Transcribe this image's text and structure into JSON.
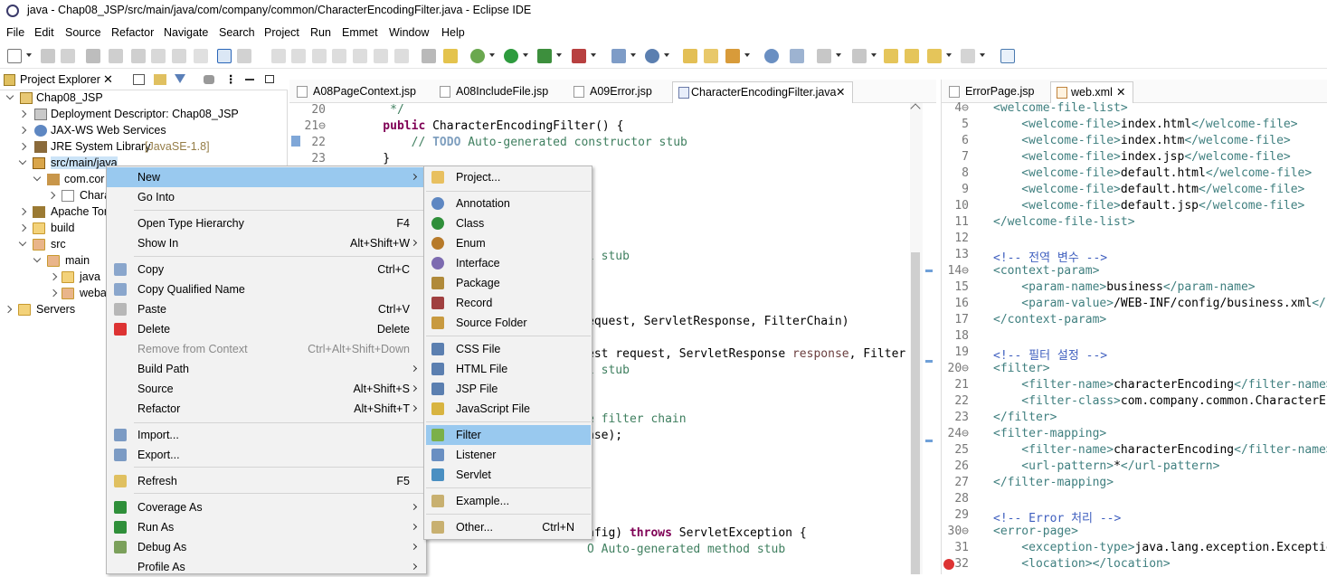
{
  "title_bar": {
    "title": "java - Chap08_JSP/src/main/java/com/company/common/CharacterEncodingFilter.java - Eclipse IDE"
  },
  "menu_bar": [
    "File",
    "Edit",
    "Source",
    "Refactor",
    "Navigate",
    "Search",
    "Project",
    "Run",
    "Emmet",
    "Window",
    "Help"
  ],
  "project_explorer": {
    "tab_label": "Project Explorer",
    "tree": [
      {
        "label": "Chap08_JSP"
      },
      {
        "label": "Deployment Descriptor: Chap08_JSP"
      },
      {
        "label": "JAX-WS Web Services"
      },
      {
        "label": "JRE System Library",
        "extra": "[JavaSE-1.8]"
      },
      {
        "label": "src/main/java"
      },
      {
        "label": "com.cor"
      },
      {
        "label": "Chara"
      },
      {
        "label": "Apache Tor"
      },
      {
        "label": "build"
      },
      {
        "label": "src"
      },
      {
        "label": "main"
      },
      {
        "label": "java"
      },
      {
        "label": "weba"
      },
      {
        "label": "Servers"
      }
    ]
  },
  "editor": {
    "tabs": [
      "A08PageContext.jsp",
      "A08IncludeFile.jsp",
      "A09Error.jsp",
      "CharacterEncodingFilter.java"
    ],
    "lines": [
      {
        "n": "20",
        "text": "     */"
      },
      {
        "n": "21⊖",
        "kw": "    public ",
        "text": "CharacterEncodingFilter() {"
      },
      {
        "n": "22",
        "cm": "        // ",
        "todo": "TODO",
        "cm2": " Auto-generated constructor stub"
      },
      {
        "n": "23",
        "text": "    }"
      }
    ],
    "fragments": {
      "f1": "l stub",
      "f2": "equest, ServletResponse, FilterChain)",
      "f3a": "est request, ServletResponse ",
      "f3b": "response",
      "f3c": ", Filter",
      "f4": "l stub",
      "f5": "e filter chain",
      "f6": "nse);",
      "f7a": "nfig) ",
      "f7b": "throws",
      "f7c": " ServletException {",
      "f8": "O Auto-generated method stub"
    }
  },
  "xml_editor": {
    "tabs": [
      "ErrorPage.jsp",
      "web.xml"
    ],
    "lines": [
      {
        "n": "4⊖",
        "t": "<welcome-file-list>"
      },
      {
        "n": "5",
        "t": "    <welcome-file>",
        "v": "index.html",
        "e": "</welcome-file>"
      },
      {
        "n": "6",
        "t": "    <welcome-file>",
        "v": "index.htm",
        "e": "</welcome-file>"
      },
      {
        "n": "7",
        "t": "    <welcome-file>",
        "v": "index.jsp",
        "e": "</welcome-file>"
      },
      {
        "n": "8",
        "t": "    <welcome-file>",
        "v": "default.html",
        "e": "</welcome-file>"
      },
      {
        "n": "9",
        "t": "    <welcome-file>",
        "v": "default.htm",
        "e": "</welcome-file>"
      },
      {
        "n": "10",
        "t": "    <welcome-file>",
        "v": "default.jsp",
        "e": "</welcome-file>"
      },
      {
        "n": "11",
        "t": "</welcome-file-list>"
      },
      {
        "n": "12",
        "t": ""
      },
      {
        "n": "13",
        "c": "<!-- 전역 변수 -->"
      },
      {
        "n": "14⊖",
        "t": "<context-param>"
      },
      {
        "n": "15",
        "t": "    <param-name>",
        "v": "business",
        "e": "</param-name>"
      },
      {
        "n": "16",
        "t": "    <param-value>",
        "v": "/WEB-INF/config/business.xml",
        "e": "</pa"
      },
      {
        "n": "17",
        "t": "</context-param>"
      },
      {
        "n": "18",
        "t": ""
      },
      {
        "n": "19",
        "c": "<!-- 필터 설정 -->"
      },
      {
        "n": "20⊖",
        "t": "<filter>"
      },
      {
        "n": "21",
        "t": "    <filter-name>",
        "v": "characterEncoding",
        "e": "</filter-name>"
      },
      {
        "n": "22",
        "t": "    <filter-class>",
        "v": "com.company.common.CharacterEnc",
        "e": ""
      },
      {
        "n": "23",
        "t": "</filter>"
      },
      {
        "n": "24⊖",
        "t": "<filter-mapping>"
      },
      {
        "n": "25",
        "t": "    <filter-name>",
        "v": "characterEncoding",
        "e": "</filter-name>"
      },
      {
        "n": "26",
        "t": "    <url-pattern>",
        "v": "*",
        "e": "</url-pattern>"
      },
      {
        "n": "27",
        "t": "</filter-mapping>"
      },
      {
        "n": "28",
        "t": ""
      },
      {
        "n": "29",
        "c": "<!-- Error 처리 -->"
      },
      {
        "n": "30⊖",
        "t": "<error-page>"
      },
      {
        "n": "31",
        "t": "    <exception-type>",
        "v": "java.lang.exception.Exceptio",
        "e": ""
      },
      {
        "n": "32",
        "t": "    <location>",
        "v": "",
        "e": "</location>"
      }
    ]
  },
  "context_menu": {
    "items": [
      {
        "label": "New",
        "shortcut": "",
        "submenu": true,
        "selected": true
      },
      {
        "label": "Go Into",
        "shortcut": ""
      },
      {
        "label": "Open Type Hierarchy",
        "shortcut": "F4"
      },
      {
        "label": "Show In",
        "shortcut": "Alt+Shift+W",
        "submenu": true
      },
      {
        "label": "Copy",
        "shortcut": "Ctrl+C"
      },
      {
        "label": "Copy Qualified Name",
        "shortcut": ""
      },
      {
        "label": "Paste",
        "shortcut": "Ctrl+V"
      },
      {
        "label": "Delete",
        "shortcut": "Delete"
      },
      {
        "label": "Remove from Context",
        "shortcut": "Ctrl+Alt+Shift+Down",
        "disabled": true
      },
      {
        "label": "Build Path",
        "shortcut": "",
        "submenu": true
      },
      {
        "label": "Source",
        "shortcut": "Alt+Shift+S",
        "submenu": true
      },
      {
        "label": "Refactor",
        "shortcut": "Alt+Shift+T",
        "submenu": true
      },
      {
        "label": "Import...",
        "shortcut": ""
      },
      {
        "label": "Export...",
        "shortcut": ""
      },
      {
        "label": "Refresh",
        "shortcut": "F5"
      },
      {
        "label": "Coverage As",
        "shortcut": "",
        "submenu": true
      },
      {
        "label": "Run As",
        "shortcut": "",
        "submenu": true
      },
      {
        "label": "Debug As",
        "shortcut": "",
        "submenu": true
      },
      {
        "label": "Profile As",
        "shortcut": "",
        "submenu": true
      }
    ]
  },
  "new_submenu": {
    "items": [
      {
        "label": "Project..."
      },
      {
        "label": "Annotation"
      },
      {
        "label": "Class"
      },
      {
        "label": "Enum"
      },
      {
        "label": "Interface"
      },
      {
        "label": "Package"
      },
      {
        "label": "Record"
      },
      {
        "label": "Source Folder"
      },
      {
        "label": "CSS File"
      },
      {
        "label": "HTML File"
      },
      {
        "label": "JSP File"
      },
      {
        "label": "JavaScript File"
      },
      {
        "label": "Filter",
        "selected": true
      },
      {
        "label": "Listener"
      },
      {
        "label": "Servlet"
      },
      {
        "label": "Example..."
      },
      {
        "label": "Other...",
        "shortcut": "Ctrl+N"
      }
    ]
  },
  "colors": {
    "selection": "#99c9ef",
    "keyword": "#7f0055",
    "comment": "#3f7f5f",
    "xml_tag": "#3f7f7f",
    "xml_comment": "#3f5fbf"
  }
}
